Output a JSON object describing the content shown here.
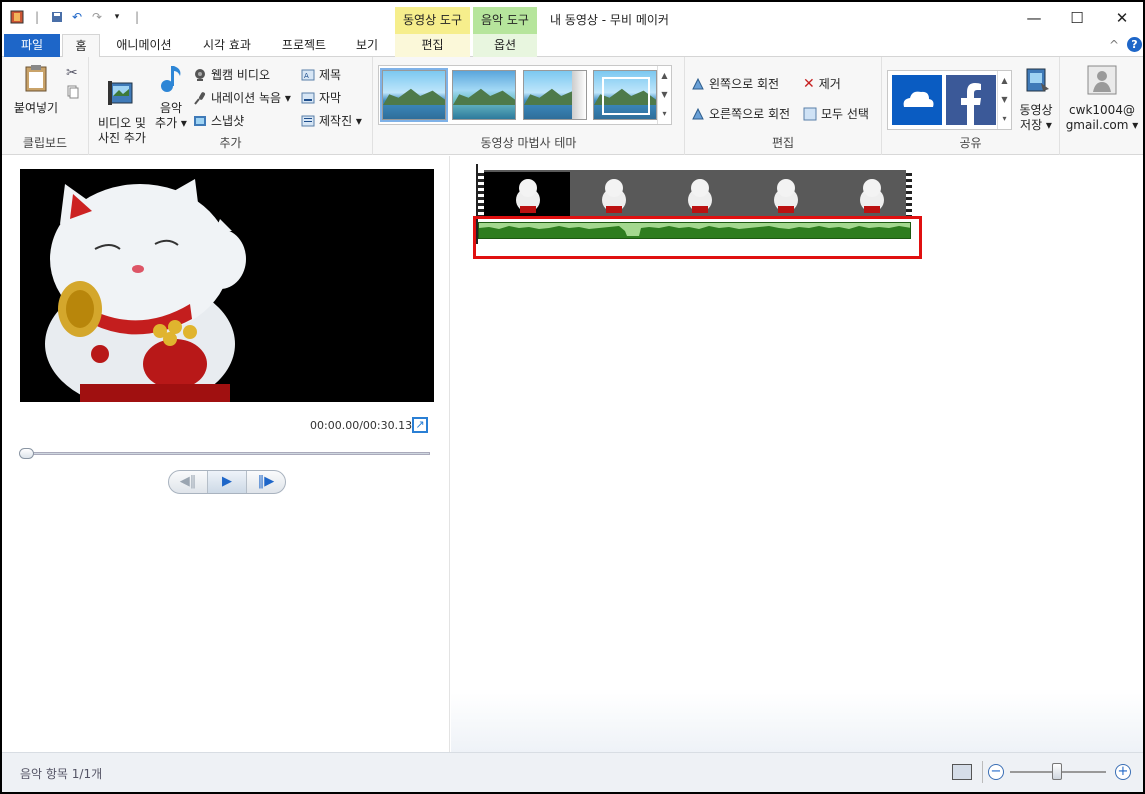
{
  "window": {
    "title": "내 동영상 - 무비 메이커",
    "minimize": "—",
    "maximize": "☐",
    "close": "✕"
  },
  "context_tabs": {
    "video_tools": "동영상 도구",
    "music_tools": "음악 도구",
    "edit": "편집",
    "options": "옵션"
  },
  "tabs": [
    "파일",
    "홈",
    "애니메이션",
    "시각 효과",
    "프로젝트",
    "보기"
  ],
  "ribbon": {
    "clipboard": {
      "paste": "붙여넣기",
      "group": "클립보드"
    },
    "add": {
      "add_video_photo": "비디오 및\n사진 추가",
      "add_music_line1": "음악",
      "add_music_line2": "추가 ▾",
      "webcam": "웹캠 비디오",
      "narration": "내레이션 녹음 ▾",
      "snapshot": "스냅샷",
      "title": "제목",
      "caption": "자막",
      "credits": "제작진 ▾",
      "group": "추가"
    },
    "themes": {
      "group": "동영상 마법사 테마"
    },
    "edit": {
      "rotate_left": "왼쪽으로 회전",
      "rotate_right": "오른쪽으로 회전",
      "remove": "제거",
      "select_all": "모두 선택",
      "group": "편집"
    },
    "share": {
      "save_movie_line1": "동영상",
      "save_movie_line2": "저장 ▾",
      "group": "공유"
    },
    "account": {
      "email_line1": "cwk1004@",
      "email_line2": "gmail.com ▾"
    }
  },
  "player": {
    "timecode": "00:00.00/00:30.13",
    "progress": 0
  },
  "status": {
    "text": "음악 항목 1/1개",
    "zoom_level": 0.45
  },
  "colors": {
    "file_tab": "#1e66c8",
    "video_tools": "#f6ee8c",
    "music_tools": "#b6e59c",
    "audio_waveform": "#2e7d1f",
    "highlight": "#e01010"
  }
}
